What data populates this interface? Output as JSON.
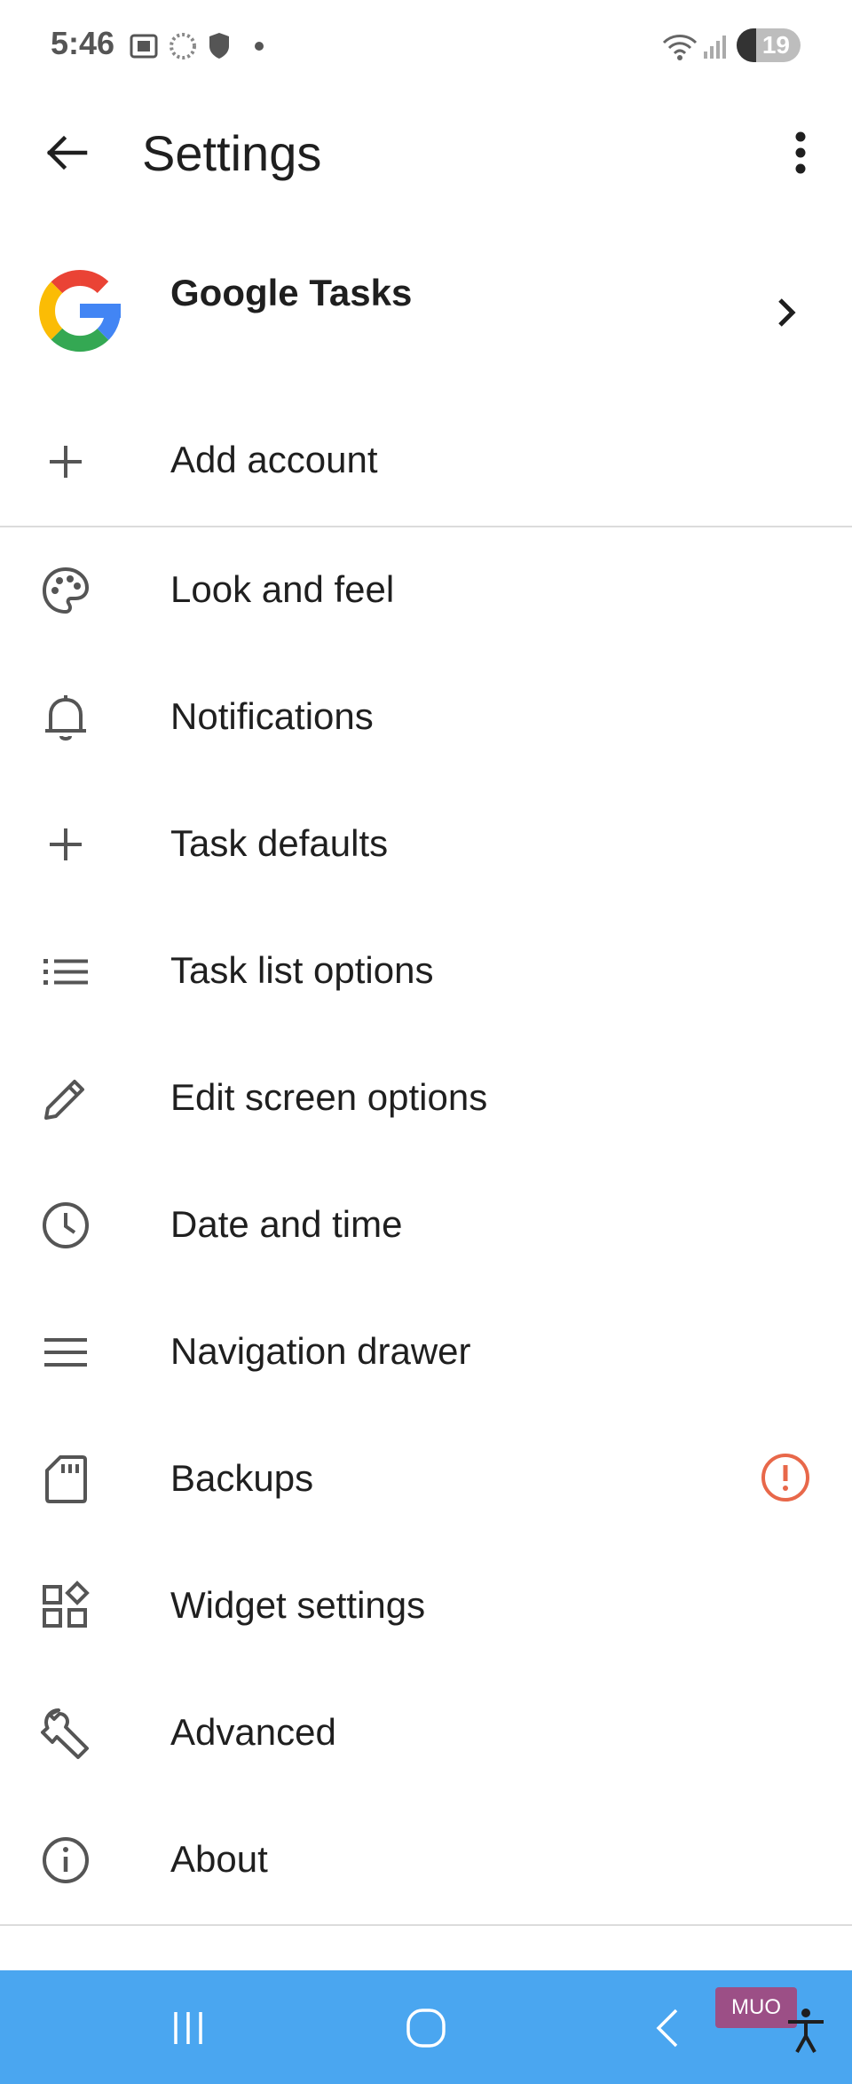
{
  "status_bar": {
    "time": "5:46",
    "battery": "19",
    "icons": [
      "screenshot-icon",
      "loading-icon",
      "shield-icon",
      "dot-icon",
      "wifi-icon",
      "signal-icon"
    ]
  },
  "app_bar": {
    "title": "Settings",
    "back_icon": "arrow-back-icon",
    "overflow_icon": "more-vert-icon"
  },
  "account": {
    "name": "Google Tasks",
    "logo": "google-logo-icon"
  },
  "add_account": {
    "label": "Add account",
    "icon": "plus-icon"
  },
  "menu": [
    {
      "label": "Look and feel",
      "icon": "palette-icon"
    },
    {
      "label": "Notifications",
      "icon": "bell-icon"
    },
    {
      "label": "Task defaults",
      "icon": "plus-icon"
    },
    {
      "label": "Task list options",
      "icon": "list-icon"
    },
    {
      "label": "Edit screen options",
      "icon": "pencil-icon"
    },
    {
      "label": "Date and time",
      "icon": "clock-icon"
    },
    {
      "label": "Navigation drawer",
      "icon": "menu-icon"
    },
    {
      "label": "Backups",
      "icon": "sd-card-icon",
      "alert_icon": "alert-circle-icon"
    },
    {
      "label": "Widget settings",
      "icon": "widgets-icon"
    },
    {
      "label": "Advanced",
      "icon": "wrench-icon"
    },
    {
      "label": "About",
      "icon": "info-icon"
    }
  ],
  "nav_bar": {
    "buttons": [
      "recents-icon",
      "home-icon",
      "back-icon"
    ],
    "watermark": "MUO"
  },
  "colors": {
    "nav_bar": "#4aa6f0",
    "alert": "#e8684a",
    "icon": "#555555",
    "text": "#1f1f1f"
  }
}
